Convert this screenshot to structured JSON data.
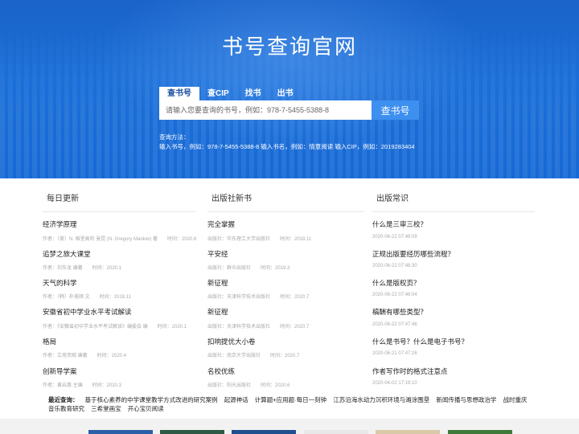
{
  "header": {
    "title": "书号查询官网",
    "tabs": [
      "查书号",
      "查CIP",
      "找书",
      "出书"
    ],
    "search": {
      "placeholder": "请输入您要查询的书号，例如：978-7-5455-5388-8",
      "button": "查书号"
    },
    "help_title": "查询方法：",
    "help_text": "输入书号，例如：978-7-5455-5388-8 输入书名，例如：情意阅读 输入CIP，例如：2019283404"
  },
  "columns": [
    {
      "heading": "每日更新",
      "items": [
        {
          "title": "经济学原理",
          "meta": "作者：（美）N. 格里高利 曼昆 (N. Gregory Mankiw) 著　　时间：2020.6"
        },
        {
          "title": "追梦之旅大课堂",
          "meta": "作者：刘东龙 编著　　时间：2020.1"
        },
        {
          "title": "天气的科学",
          "meta": "作者：（韩）朴美顺 文　　时间：2018.11"
        },
        {
          "title": "安徽省初中学业水平考试解读",
          "meta": "作者：《安徽省初中学业水平考试解读》编委会 编　　时间：2020.1"
        },
        {
          "title": "格局",
          "meta": "作者：立竞而观 编著　　时间：2020.4"
        },
        {
          "title": "创新导学案",
          "meta": "作者：黄启惠 主编　　时间：2020.3"
        }
      ]
    },
    {
      "heading": "出版社新书",
      "items": [
        {
          "title": "完全掌握",
          "meta": "出版社：华东理工大学出版社　　时间：2018.11"
        },
        {
          "title": "平安经",
          "meta": "出版社：群众出版社　　时间：2019.3"
        },
        {
          "title": "新征程",
          "meta": "出版社：天津科学技术出版社　　时间：2020.7"
        },
        {
          "title": "新征程",
          "meta": "出版社：天津科学技术出版社　　时间：2020.7"
        },
        {
          "title": "扣响提优大小卷",
          "meta": "出版社：南京大学出版社　　时间：2020.7"
        },
        {
          "title": "名校优练",
          "meta": "出版社：阳光出版社　　时间：2020.6"
        }
      ]
    },
    {
      "heading": "出版常识",
      "items": [
        {
          "title": "什么是三审三校？",
          "meta": "2020-06-22 07:49:09"
        },
        {
          "title": "正规出版要经历哪些流程？",
          "meta": "2020-06-22 07:48:30"
        },
        {
          "title": "什么是版权页？",
          "meta": "2020-06-22 07:48:04"
        },
        {
          "title": "稿酬有哪些类型？",
          "meta": "2020-06-22 07:47:46"
        },
        {
          "title": "什么是书号？什么是电子书号？",
          "meta": "2020-06-21 07:47:26"
        },
        {
          "title": "作者写作时的格式注意点",
          "meta": "2020-04-02 17:19:10"
        }
      ]
    }
  ],
  "recent": {
    "label": "最近查询：",
    "links": [
      "基于核心素养的中学课堂教学方式改进的研究案例",
      "起源神话",
      "计算题+应用题·每日一刻钟",
      "江苏沿海水动力沉积环境与滩涂围垦",
      "新闻传播与思想政治学",
      "战时重庆音乐教育研究",
      "三希堂画宝",
      "开心宝贝阅读"
    ]
  },
  "colors": {
    "hero": "#1b6fd8",
    "button": "#3d8ff0",
    "tab_active_text": "#1a4f9e"
  }
}
